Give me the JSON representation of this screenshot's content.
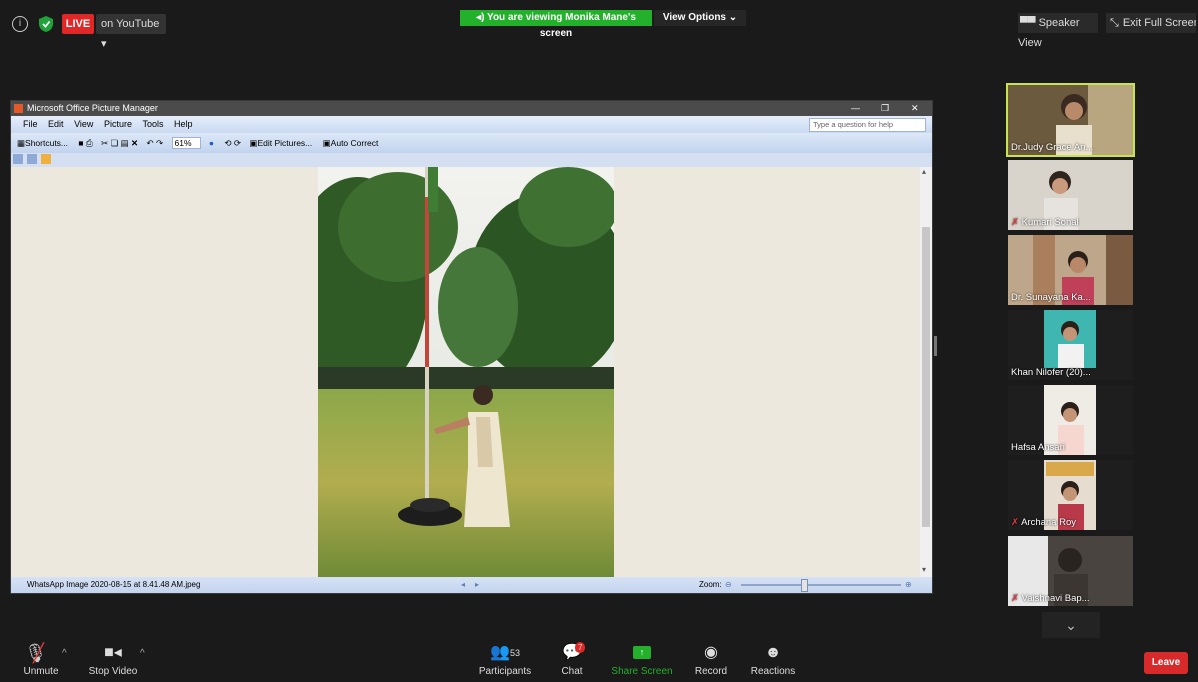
{
  "top_bar": {
    "live_label": "LIVE",
    "youtube_label": "on YouTube",
    "viewing_label": "You are viewing Monika Mane's screen",
    "view_options_label": "View Options",
    "speaker_view_label": "Speaker View",
    "exit_full_label": "Exit Full Screen"
  },
  "shared_window": {
    "title": "Microsoft Office Picture Manager",
    "menu": [
      "File",
      "Edit",
      "View",
      "Picture",
      "Tools",
      "Help"
    ],
    "help_placeholder": "Type a question for help",
    "toolbar": {
      "shortcuts_label": "Shortcuts...",
      "zoom_value": "61%",
      "edit_pictures_label": "Edit Pictures...",
      "auto_correct_label": "Auto Correct"
    },
    "status": {
      "filename": "WhatsApp Image 2020-08-15 at 8.41.48 AM.jpeg",
      "zoom_label": "Zoom:"
    }
  },
  "participants": [
    {
      "name": "Dr.Judy Grace An..."
    },
    {
      "name": "Kumari Sonal"
    },
    {
      "name": "Dr. Sunayana Ka..."
    },
    {
      "name": "Khan Nilofer (20)..."
    },
    {
      "name": "Hafsa Ansari"
    },
    {
      "name": "Archana Roy"
    },
    {
      "name": "Vaishnavi Bap..."
    }
  ],
  "bottom_bar": {
    "unmute_label": "Unmute",
    "stop_video_label": "Stop Video",
    "participants_label": "Participants",
    "participants_count": "53",
    "chat_label": "Chat",
    "chat_badge": "7",
    "share_screen_label": "Share Screen",
    "record_label": "Record",
    "reactions_label": "Reactions",
    "leave_label": "Leave"
  },
  "colors": {
    "share_green": "#23b12c",
    "live_red": "#e02828",
    "active_speaker": "#c9e34a",
    "leave_red": "#d82a2a"
  }
}
